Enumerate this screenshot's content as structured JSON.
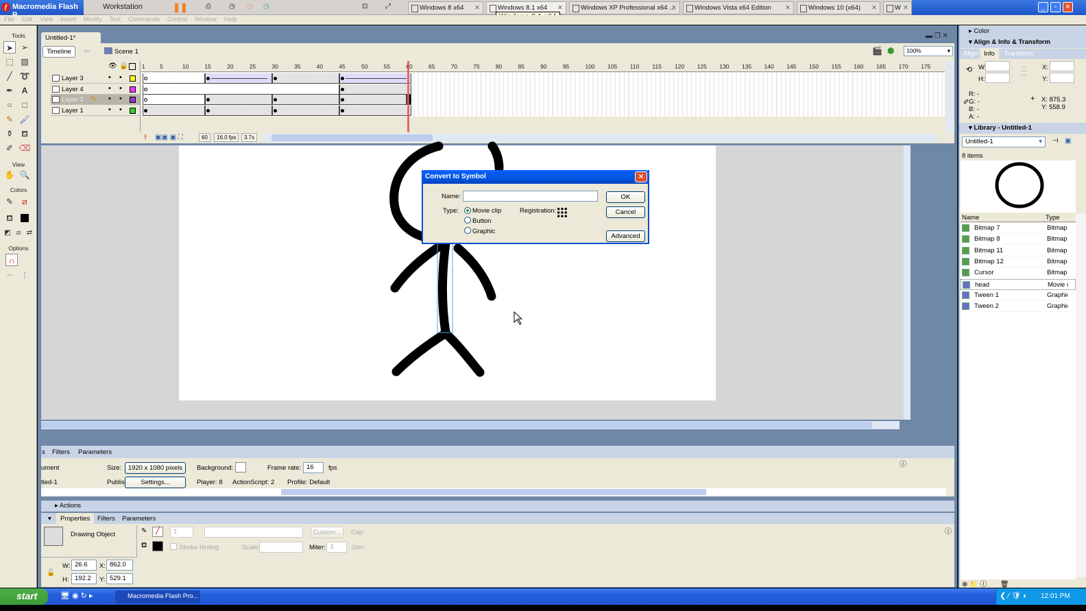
{
  "vmware": {
    "title": "Macromedia Flash P",
    "workstation": "Workstation",
    "tabs": [
      "Windows 8 x64",
      "Windows 8.1 x64",
      "Windows XP Professional x64 ...",
      "Windows Vista x64 Edition",
      "Windows 10 (x64)",
      "W"
    ],
    "tooltip": "Windows 8.1 x64"
  },
  "menu": [
    "File",
    "Edit",
    "View",
    "Insert",
    "Modify",
    "Text",
    "Commands",
    "Control",
    "Window",
    "Help"
  ],
  "tools": {
    "tools_label": "Tools",
    "view_label": "View",
    "colors_label": "Colors",
    "options_label": "Options"
  },
  "document": {
    "tab": "Untitled-1*",
    "timeline_button": "Timeline",
    "scene": "Scene 1",
    "zoom": "100%"
  },
  "timeline": {
    "ruler": [
      1,
      5,
      10,
      15,
      20,
      25,
      30,
      35,
      40,
      45,
      50,
      55,
      60,
      65,
      70,
      75,
      80,
      85,
      90,
      95,
      100,
      105,
      110,
      115,
      120,
      125,
      130,
      135,
      140,
      145,
      150,
      155,
      160,
      165,
      170,
      175
    ],
    "current_frame": 60,
    "layers": [
      {
        "name": "Layer 3",
        "color": "#ffff33",
        "spans": [
          [
            1,
            14,
            "blank"
          ],
          [
            15,
            29,
            "tween"
          ],
          [
            30,
            44,
            "static"
          ],
          [
            45,
            60,
            "tween"
          ]
        ]
      },
      {
        "name": "Layer 4",
        "color": "#ff33ff",
        "spans": [
          [
            1,
            44,
            "blank"
          ],
          [
            45,
            60,
            "static"
          ]
        ]
      },
      {
        "name": "Layer 2",
        "color": "#9933cc",
        "selected": true,
        "spans": [
          [
            1,
            14,
            "blank"
          ],
          [
            15,
            29,
            "static"
          ],
          [
            30,
            44,
            "static"
          ],
          [
            45,
            59,
            "static"
          ],
          [
            60,
            60,
            "static"
          ]
        ]
      },
      {
        "name": "Layer 1",
        "color": "#33cc33",
        "spans": [
          [
            1,
            14,
            "static"
          ],
          [
            15,
            29,
            "static"
          ],
          [
            30,
            44,
            "static"
          ],
          [
            45,
            60,
            "static"
          ]
        ]
      }
    ],
    "footer": {
      "frame": "60",
      "fps": "16.0 fps",
      "time": "3.7s"
    }
  },
  "dialog": {
    "title": "Convert to Symbol",
    "name_label": "Name:",
    "name_value": "",
    "type_label": "Type:",
    "types": [
      "Movie clip",
      "Button",
      "Graphic"
    ],
    "selected_type": "Movie clip",
    "registration_label": "Registration:",
    "ok": "OK",
    "cancel": "Cancel",
    "advanced": "Advanced"
  },
  "doc_props": {
    "tabs": [
      "s",
      "Filters",
      "Parameters"
    ],
    "type_label": "ument",
    "name": "tled-1",
    "size_label": "Size:",
    "size": "1920 x 1080 pixels",
    "background_label": "Background:",
    "framerate_label": "Frame rate:",
    "framerate": "16",
    "fps": "fps",
    "publish_label": "Publish:",
    "settings": "Settings...",
    "player": "Player: 8",
    "actionscript": "ActionScript: 2",
    "profile": "Profile: Default"
  },
  "actions_label": "Actions",
  "props": {
    "tabs": [
      "Properties",
      "Filters",
      "Parameters"
    ],
    "object": "Drawing Object",
    "stroke_width": "1",
    "custom": "Custom...",
    "cap": "Cap:",
    "stroke_hinting": "Stroke hinting",
    "scale": "Scale:",
    "miter_label": "Miter:",
    "miter": "3",
    "join": "Join:",
    "w_label": "W:",
    "w": "26.6",
    "h_label": "H:",
    "h": "192.2",
    "x_label": "X:",
    "x": "862.0",
    "y_label": "Y:",
    "y": "529.1"
  },
  "right": {
    "color": "Color",
    "align_title": "Align & Info & Transform",
    "align_tabs": [
      "Align",
      "Info",
      "Transform"
    ],
    "info": {
      "w": "W:",
      "h": "H:",
      "x": "X:",
      "y": "Y:",
      "r": "R: -",
      "g": "G: -",
      "b": "B: -",
      "a": "A: -",
      "cx": "X: 875.3",
      "cy": "Y: 558.9"
    },
    "library_title": "Library - Untitled-1",
    "library_doc": "Untitled-1",
    "count": "8 items",
    "col_name": "Name",
    "col_type": "Type",
    "items": [
      {
        "name": "Bitmap 7",
        "type": "Bitmap"
      },
      {
        "name": "Bitmap 8",
        "type": "Bitmap"
      },
      {
        "name": "Bitmap 11",
        "type": "Bitmap"
      },
      {
        "name": "Bitmap 12",
        "type": "Bitmap"
      },
      {
        "name": "Cursor",
        "type": "Bitmap"
      },
      {
        "name": "head",
        "type": "Movie clip"
      },
      {
        "name": "Tween 1",
        "type": "Graphic"
      },
      {
        "name": "Tween 2",
        "type": "Graphic"
      }
    ]
  },
  "taskbar": {
    "start": "start",
    "task": "Macromedia Flash Pro...",
    "clock": "12:01 PM"
  }
}
